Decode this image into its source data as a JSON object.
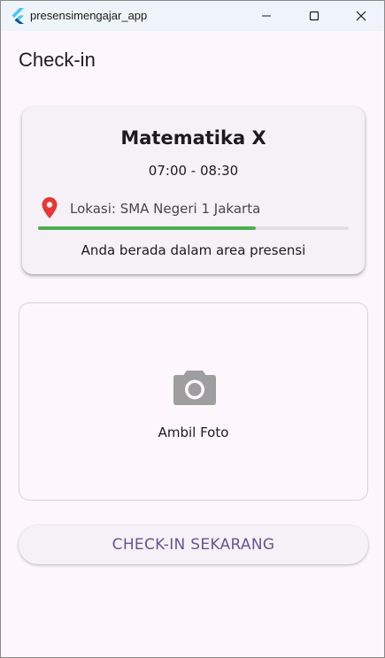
{
  "window": {
    "title": "presensimengajar_app"
  },
  "appbar": {
    "title": "Check-in"
  },
  "info_card": {
    "subject": "Matematika X",
    "time": "07:00 - 08:30",
    "location": "Lokasi: SMA Negeri 1 Jakarta",
    "progress_fraction": 0.7,
    "status": "Anda berada dalam area presensi"
  },
  "photo": {
    "label": "Ambil Foto"
  },
  "actions": {
    "checkin_label": "CHECK-IN SEKARANG"
  },
  "colors": {
    "progress": "#4caf50",
    "location_icon": "#e53935",
    "camera_icon": "#9e9e9e",
    "button_text": "#6a5494"
  }
}
